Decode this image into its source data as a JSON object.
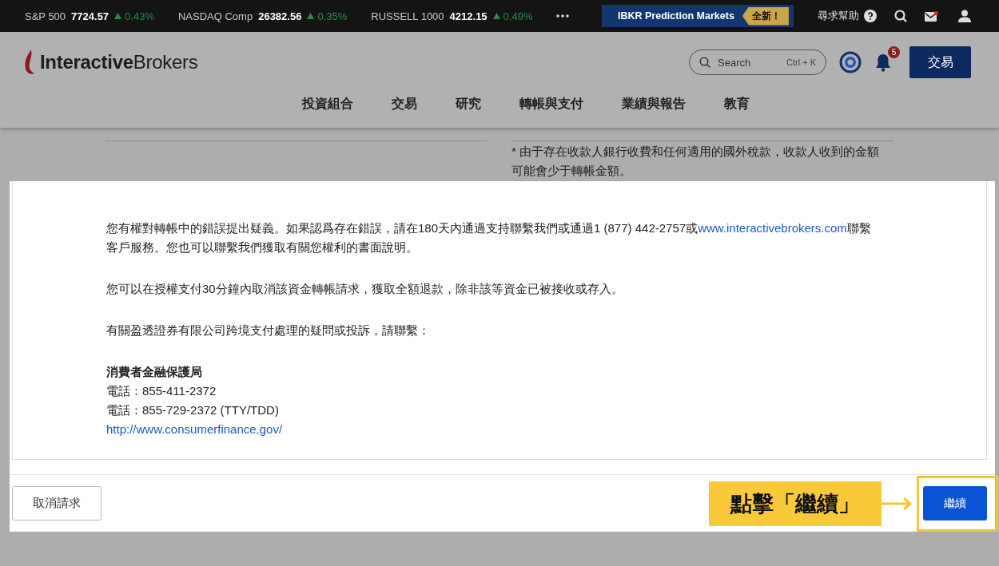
{
  "ticker": [
    {
      "name": "S&P 500",
      "value": "7724.57",
      "change": "0.43%",
      "rising": true
    },
    {
      "name": "NASDAQ Comp",
      "value": "26382.56",
      "change": "0.35%",
      "rising": true
    },
    {
      "name": "RUSSELL 1000",
      "value": "4212.15",
      "change": "0.49%",
      "rising": true
    }
  ],
  "promo": {
    "label": "IBKR Prediction Markets",
    "badge": "全新！"
  },
  "help": {
    "label": "尋求幫助"
  },
  "mail": {
    "unread": true
  },
  "logo": {
    "text": "**Interactive**Brokers"
  },
  "search": {
    "placeholder": "Search",
    "shortcut": "Ctrl + K"
  },
  "notifications": {
    "count": "5"
  },
  "trade_button": "交易",
  "nav": [
    "投資組合",
    "交易",
    "研究",
    "轉帳與支付",
    "業績與報告",
    "教育"
  ],
  "background_note": "* 由于存在收款人銀行收費和任何適用的國外稅款，收款人收到的金額可能會少于轉帳金額。",
  "dialog": {
    "dispute_paragraph": {
      "before": "您有權對轉帳中的錯誤提出疑義。如果認爲存在錯誤，請在180天內通過支持聯繫我們或通過1 (877) 442-2757或",
      "link": "www.interactivebrokers.com",
      "after": "聯繫客戶服務。您也可以聯繫我們獲取有關您權利的書面說明。"
    },
    "paragraphs": [
      "您可以在授權支付30分鐘內取消該資金轉帳請求，獲取全額退款，除非該等資金已被接收或存入。",
      "有關盈透證券有限公司跨境支付處理的疑問或投訴，請聯繫："
    ],
    "contact": {
      "title": "消費者金融保護局",
      "lines": [
        "電話：855-411-2372",
        "電話：855-729-2372 (TTY/TDD)"
      ],
      "link": "http://www.consumerfinance.gov/"
    },
    "cancel_button": "取消請求",
    "continue_button": "繼續"
  },
  "annotation": {
    "text": "點擊「繼續」"
  }
}
